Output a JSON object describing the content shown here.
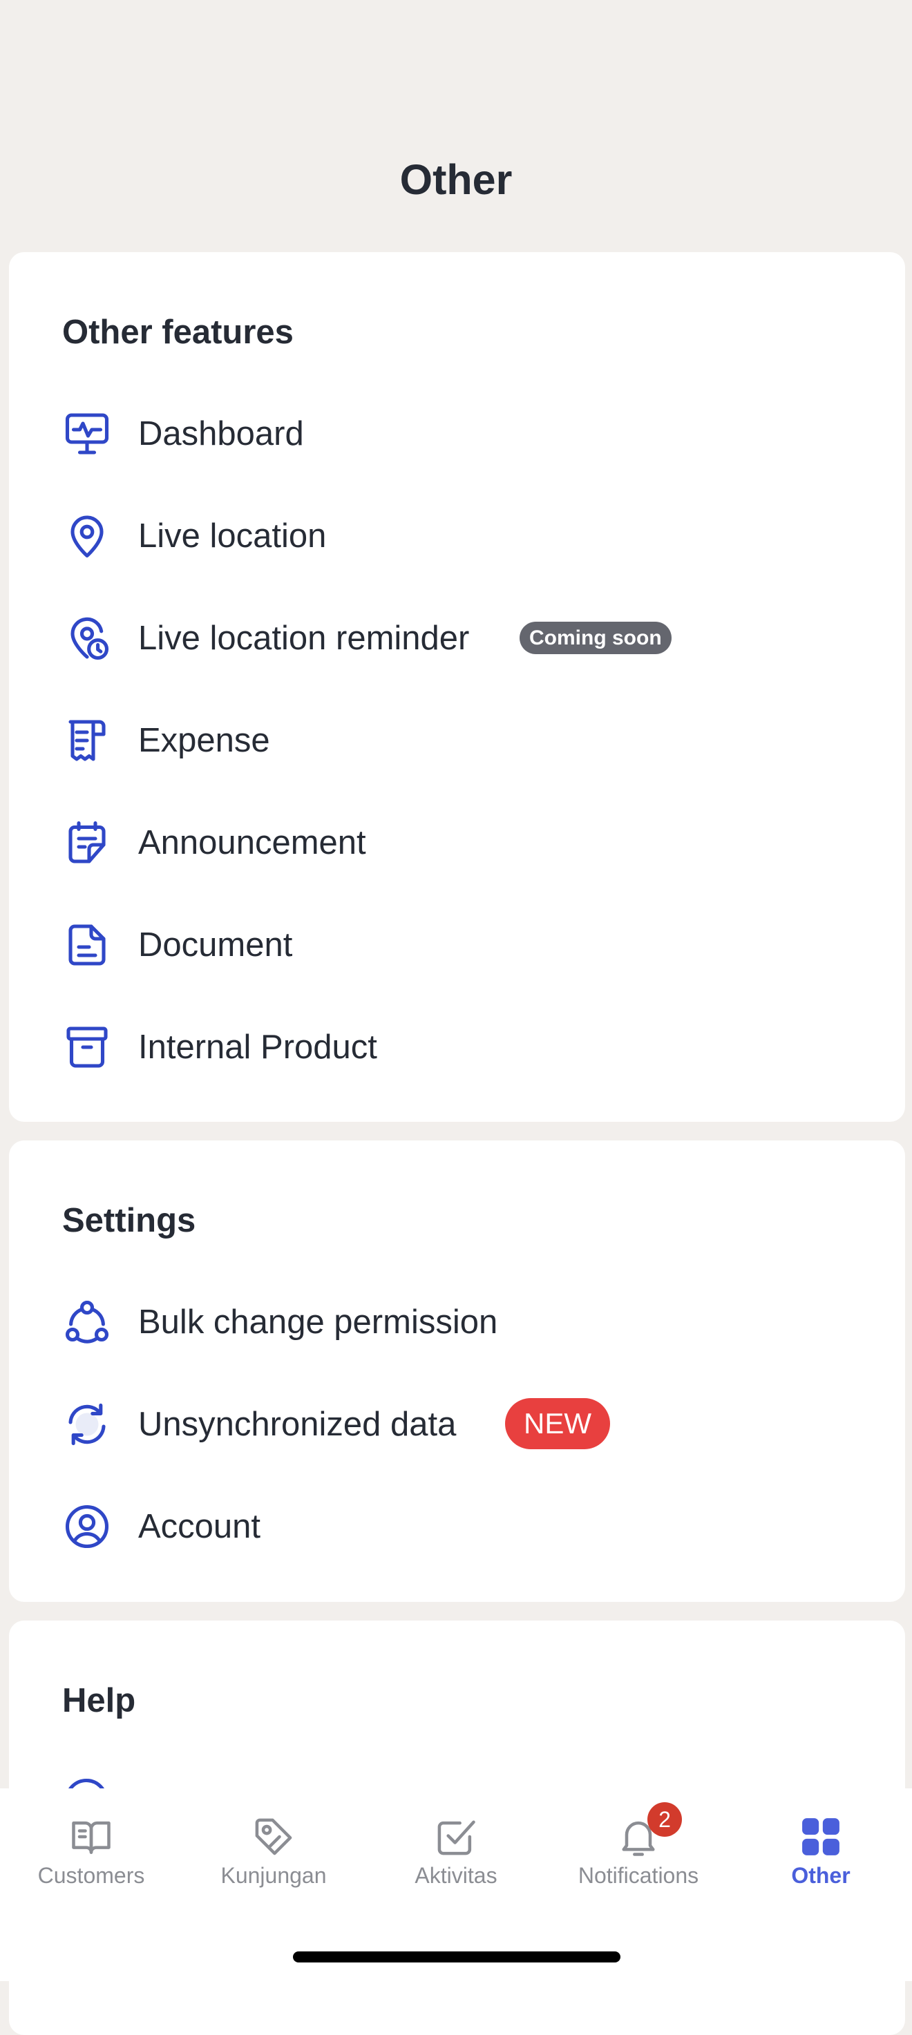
{
  "header": {
    "title": "Other"
  },
  "sections": {
    "features": {
      "title": "Other features",
      "items": [
        {
          "label": "Dashboard",
          "icon": "dashboard-monitor-icon"
        },
        {
          "label": "Live location",
          "icon": "map-pin-icon"
        },
        {
          "label": "Live location reminder",
          "icon": "pin-clock-icon",
          "badge": "Coming soon"
        },
        {
          "label": "Expense",
          "icon": "receipt-icon"
        },
        {
          "label": "Announcement",
          "icon": "calendar-note-icon"
        },
        {
          "label": "Document",
          "icon": "document-icon"
        },
        {
          "label": "Internal Product",
          "icon": "archive-box-icon"
        }
      ]
    },
    "settings": {
      "title": "Settings",
      "items": [
        {
          "label": "Bulk change permission",
          "icon": "network-nodes-icon"
        },
        {
          "label": "Unsynchronized data",
          "icon": "sync-icon",
          "badge": "NEW"
        },
        {
          "label": "Account",
          "icon": "user-circle-icon"
        }
      ]
    },
    "help": {
      "title": "Help"
    }
  },
  "bottom_nav": {
    "items": [
      {
        "label": "Customers",
        "icon": "book-icon"
      },
      {
        "label": "Kunjungan",
        "icon": "tag-icon"
      },
      {
        "label": "Aktivitas",
        "icon": "check-square-icon"
      },
      {
        "label": "Notifications",
        "icon": "bell-icon",
        "count": "2"
      },
      {
        "label": "Other",
        "icon": "grid-icon",
        "active": true
      }
    ]
  },
  "colors": {
    "accent": "#2f47c7",
    "active_nav": "#4a5fdb",
    "new_badge": "#e8403f",
    "soon_badge": "#64666e",
    "notification_badge": "#d23b2c",
    "background": "#f2efec"
  }
}
